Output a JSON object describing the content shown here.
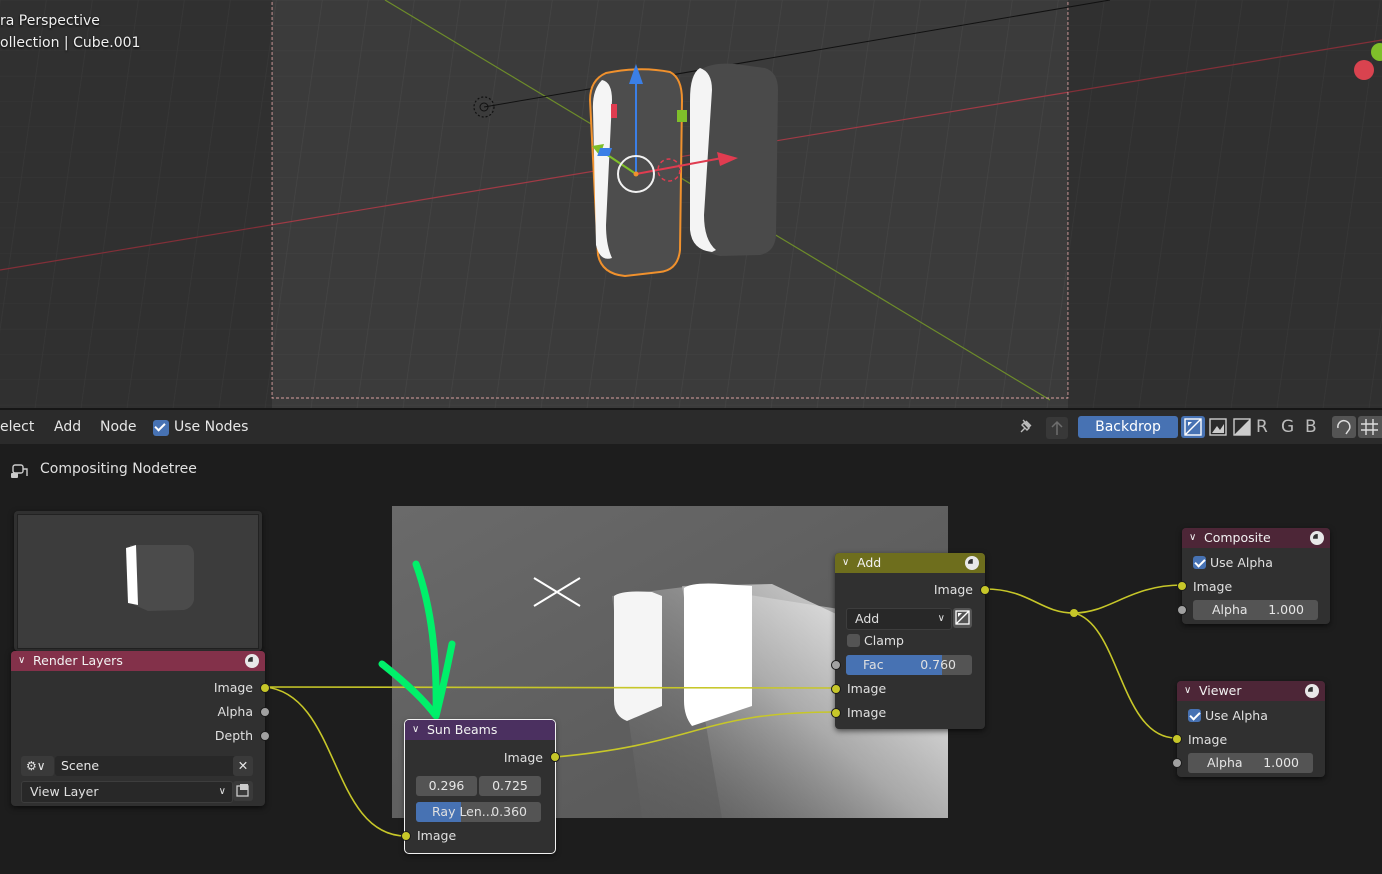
{
  "viewport": {
    "overlay_line1": "ra Perspective",
    "overlay_line2": "ollection | Cube.001"
  },
  "header": {
    "menu": [
      "elect",
      "Add",
      "Node"
    ],
    "use_nodes_label": "Use Nodes",
    "use_nodes_checked": true,
    "backdrop_label": "Backdrop",
    "channel_buttons": [
      "R",
      "G",
      "B"
    ],
    "icons": [
      "pin-icon",
      "parent-up-icon",
      "backdrop-rgb-icon",
      "backdrop-alpha-icon",
      "backdrop-rgba-icon",
      "gizmo-icon",
      "grid-icon"
    ]
  },
  "breadcrumb": {
    "label": "Compositing Nodetree",
    "icon": "nodetree-icon"
  },
  "nodes": {
    "render_layers": {
      "title": "Render Layers",
      "outputs": [
        "Image",
        "Alpha",
        "Depth"
      ],
      "scene_value": "Scene",
      "view_layer_value": "View Layer"
    },
    "sun_beams": {
      "title": "Sun Beams",
      "output": "Image",
      "source_x": "0.296",
      "source_y": "0.725",
      "ray_length_label": "Ray Len...",
      "ray_length_value": "0.360",
      "ray_length_fraction": 0.36,
      "input": "Image"
    },
    "add": {
      "title": "Add",
      "output": "Image",
      "blend_mode": "Add",
      "clamp_label": "Clamp",
      "clamp_checked": false,
      "fac_label": "Fac",
      "fac_value": "0.760",
      "fac_fraction": 0.76,
      "inputs": [
        "Image",
        "Image"
      ]
    },
    "composite": {
      "title": "Composite",
      "use_alpha_label": "Use Alpha",
      "use_alpha_checked": true,
      "input": "Image",
      "alpha_label": "Alpha",
      "alpha_value": "1.000"
    },
    "viewer": {
      "title": "Viewer",
      "use_alpha_label": "Use Alpha",
      "use_alpha_checked": true,
      "input": "Image",
      "alpha_label": "Alpha",
      "alpha_value": "1.000"
    }
  },
  "colors": {
    "input_node_header": "#83314a",
    "filter_node_header": "#4b3060",
    "color_node_header": "#6e6e1d",
    "output_node_header": "#4d2637",
    "image_socket": "#c7c729",
    "annotation_arrow": "#00f06a",
    "accent_blue": "#4772b3",
    "selection_orange": "#f0912d"
  }
}
